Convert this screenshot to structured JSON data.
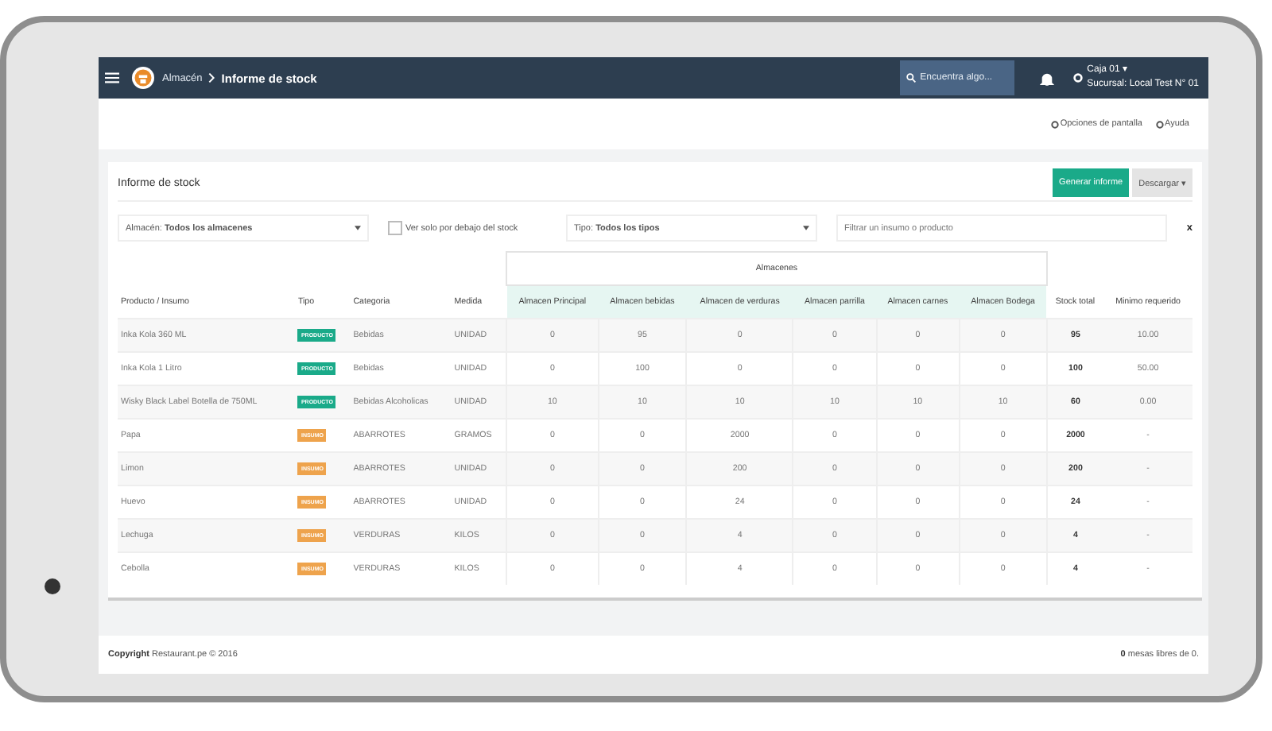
{
  "navbar": {
    "breadcrumb_parent": "Almacén",
    "breadcrumb_current": "Informe de stock",
    "search": {
      "placeholder": "Encuentra algo..."
    },
    "caja": "Caja 01 ▾",
    "sucursal": "Sucursal: Local Test N° 01"
  },
  "subbar": {
    "links": [
      "Opciones de pantalla",
      "Ayuda"
    ]
  },
  "card": {
    "title": "Informe de stock",
    "buttons": [
      {
        "label": "Generar informe",
        "kind": "primary"
      },
      {
        "label": "Descargar ▾",
        "kind": "default"
      }
    ]
  },
  "filters": {
    "almacen": {
      "label": "Almacén:",
      "value": "Todos los almacenes"
    },
    "below_stock": {
      "label": "Ver solo por debajo del stock",
      "checked": false
    },
    "tipo": {
      "label": "Tipo:",
      "value": "Todos los tipos"
    },
    "search": {
      "placeholder": "Filtrar un insumo o producto"
    },
    "clear": "x"
  },
  "table": {
    "group_header": "Almacenes",
    "columns": [
      "Producto / Insumo",
      "Tipo",
      "Categoria",
      "Medida",
      "Almacen Principal",
      "Almacen bebidas",
      "Almacen de verduras",
      "Almacen parrilla",
      "Almacen carnes",
      "Almacen Bodega",
      "Stock total",
      "Minimo requerido"
    ],
    "rows": [
      {
        "name": "Inka Kola 360 ML",
        "tipo": {
          "label": "PRODUCTO",
          "kind": "producto"
        },
        "categoria": "Bebidas",
        "medida": "UNIDAD",
        "stock": [
          "0",
          "95",
          "0",
          "0",
          "0",
          "0"
        ],
        "total": "95",
        "minimo": "10.00"
      },
      {
        "name": "Inka Kola 1 Litro",
        "tipo": {
          "label": "PRODUCTO",
          "kind": "producto"
        },
        "categoria": "Bebidas",
        "medida": "UNIDAD",
        "stock": [
          "0",
          "100",
          "0",
          "0",
          "0",
          "0"
        ],
        "total": "100",
        "minimo": "50.00"
      },
      {
        "name": "Wisky Black Label Botella de 750ML",
        "tipo": {
          "label": "PRODUCTO",
          "kind": "producto"
        },
        "categoria": "Bebidas Alcoholicas",
        "medida": "UNIDAD",
        "stock": [
          "10",
          "10",
          "10",
          "10",
          "10",
          "10"
        ],
        "total": "60",
        "minimo": "0.00"
      },
      {
        "name": "Papa",
        "tipo": {
          "label": "INSUMO",
          "kind": "insumo"
        },
        "categoria": "ABARROTES",
        "medida": "GRAMOS",
        "stock": [
          "0",
          "0",
          "2000",
          "0",
          "0",
          "0"
        ],
        "total": "2000",
        "minimo": "-"
      },
      {
        "name": "Limon",
        "tipo": {
          "label": "INSUMO",
          "kind": "insumo"
        },
        "categoria": "ABARROTES",
        "medida": "UNIDAD",
        "stock": [
          "0",
          "0",
          "200",
          "0",
          "0",
          "0"
        ],
        "total": "200",
        "minimo": "-"
      },
      {
        "name": "Huevo",
        "tipo": {
          "label": "INSUMO",
          "kind": "insumo"
        },
        "categoria": "ABARROTES",
        "medida": "UNIDAD",
        "stock": [
          "0",
          "0",
          "24",
          "0",
          "0",
          "0"
        ],
        "total": "24",
        "minimo": "-"
      },
      {
        "name": "Lechuga",
        "tipo": {
          "label": "INSUMO",
          "kind": "insumo"
        },
        "categoria": "VERDURAS",
        "medida": "KILOS",
        "stock": [
          "0",
          "0",
          "4",
          "0",
          "0",
          "0"
        ],
        "total": "4",
        "minimo": "-"
      },
      {
        "name": "Cebolla",
        "tipo": {
          "label": "INSUMO",
          "kind": "insumo"
        },
        "categoria": "VERDURAS",
        "medida": "KILOS",
        "stock": [
          "0",
          "0",
          "4",
          "0",
          "0",
          "0"
        ],
        "total": "4",
        "minimo": "-"
      }
    ]
  },
  "footer": {
    "copyright_label": "Copyright",
    "copyright_text": "Restaurant.pe © 2016",
    "mesas_count": "0",
    "mesas_text": "mesas libres de 0."
  }
}
